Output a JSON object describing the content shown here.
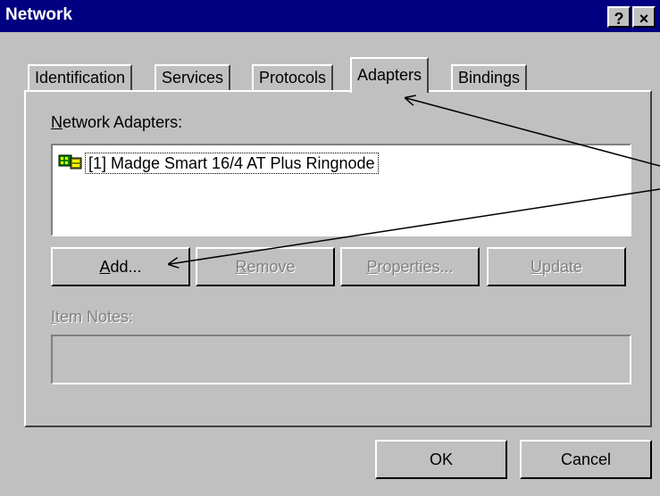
{
  "window": {
    "title": "Network",
    "help_label": "?",
    "close_label": "×"
  },
  "tabs": [
    {
      "label": "Identification"
    },
    {
      "label": "Services"
    },
    {
      "label": "Protocols"
    },
    {
      "label": "Adapters"
    },
    {
      "label": "Bindings"
    }
  ],
  "adapters_panel": {
    "list_label": "Network Adapters:",
    "list_label_accel": "N",
    "list_label_rest": "etwork Adapters:",
    "items": [
      {
        "label": "[1] Madge Smart 16/4 AT Plus Ringnode",
        "icon": "network-adapter-icon"
      }
    ],
    "buttons": {
      "add": {
        "accel": "A",
        "rest": "dd..."
      },
      "remove": {
        "accel": "R",
        "rest": "emove"
      },
      "properties": {
        "accel": "P",
        "rest": "roperties..."
      },
      "update": {
        "accel": "U",
        "rest": "pdate"
      }
    },
    "item_notes_label_accel": "I",
    "item_notes_label_rest": "tem Notes:",
    "item_notes_value": ""
  },
  "footer": {
    "ok_label": "OK",
    "cancel_label": "Cancel"
  }
}
